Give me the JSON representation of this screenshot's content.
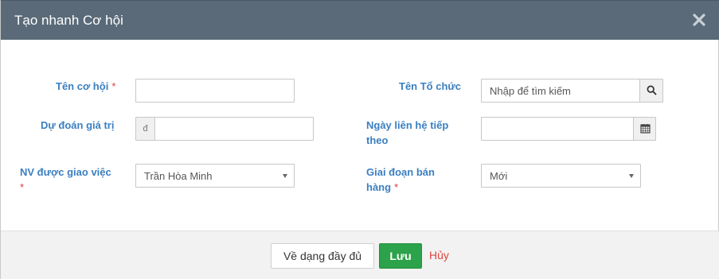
{
  "modal": {
    "title": "Tạo nhanh Cơ hội"
  },
  "form": {
    "opportunity_name": {
      "label": "Tên cơ hội",
      "required": "*",
      "value": ""
    },
    "organization": {
      "label": "Tên Tổ chức",
      "placeholder": "Nhập để tìm kiếm",
      "icon": "search-icon"
    },
    "estimated_value": {
      "label": "Dự đoán giá trị",
      "currency": "đ",
      "value": ""
    },
    "next_contact_date": {
      "label_line1": "Ngày liên hệ tiếp",
      "label_line2": "theo",
      "value": "",
      "icon": "calendar-icon"
    },
    "assigned_staff": {
      "label": "NV được giao việc",
      "required": "*",
      "selected": "Trần Hòa Minh"
    },
    "sales_stage": {
      "label_line1": "Giai đoạn bán",
      "label_line2": "hàng",
      "required": "*",
      "selected": "Mới"
    }
  },
  "footer": {
    "full_form_label": "Về dạng đầy đủ",
    "save_label": "Lưu",
    "cancel_label": "Hủy"
  },
  "colors": {
    "header_bg": "#5a6a78",
    "label": "#3a7fc1",
    "required": "#e03b3b",
    "save_btn": "#2ca24a",
    "cancel_link": "#e0453c"
  }
}
